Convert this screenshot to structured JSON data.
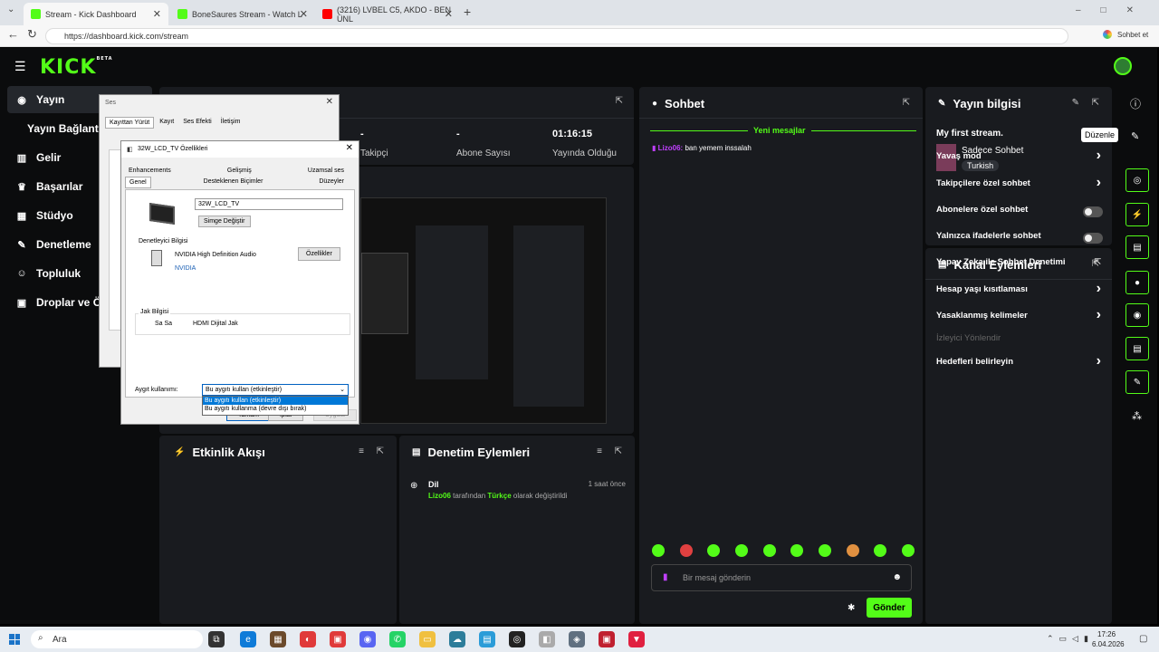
{
  "browser": {
    "tabs": [
      {
        "title": "Stream - Kick Dashboard",
        "color": "#53fc18"
      },
      {
        "title": "BoneSaures Stream - Watch L",
        "color": "#53fc18"
      },
      {
        "title": "(3216) LVBEL C5, AKDO - BEN ÜNL",
        "color": "#ff0000"
      }
    ],
    "url": "https://dashboard.kick.com/stream",
    "chat_label": "Sohbet et"
  },
  "logo": {
    "text": "KICK",
    "badge": "BETA"
  },
  "sidebar": {
    "items": [
      {
        "label": "Yayın",
        "icon": "broadcast-icon"
      },
      {
        "label": "Yayın Bağlantısı",
        "icon": ""
      },
      {
        "label": "Gelir",
        "icon": "chart-icon"
      },
      {
        "label": "Başarılar",
        "icon": "trophy-icon"
      },
      {
        "label": "Stüdyo",
        "icon": "studio-icon"
      },
      {
        "label": "Denetleme",
        "icon": "wrench-icon"
      },
      {
        "label": "Topluluk",
        "icon": "people-icon"
      },
      {
        "label": "Droplar ve Ödüller",
        "icon": "gift-icon"
      }
    ]
  },
  "stats": [
    {
      "value": "-",
      "label": "Takipçi"
    },
    {
      "value": "-",
      "label": "Abone Sayısı"
    },
    {
      "value": "01:16:15",
      "label": "Yayında Olduğu Süre"
    }
  ],
  "chat": {
    "title": "Sohbet",
    "new_messages": "Yeni mesajlar",
    "messages": [
      {
        "user": "Lizo06:",
        "text": "ban yemem inssalah"
      }
    ],
    "input_placeholder": "Bir mesaj gönderin",
    "send_label": "Gönder"
  },
  "stream_info": {
    "title": "Yayın bilgisi",
    "stream_title": "My first stream.",
    "category": "Sadece Sohbet",
    "tag": "Turkish",
    "tooltip": "Düzenle"
  },
  "channel_actions": {
    "title": "Kanal Eylemleri",
    "items": [
      {
        "label": "Yavaş mod",
        "control": "chevron"
      },
      {
        "label": "Takipçilere özel sohbet",
        "control": "chevron"
      },
      {
        "label": "Abonelere özel sohbet",
        "control": "toggle"
      },
      {
        "label": "Yalnızca ifadelerle sohbet",
        "control": "toggle"
      },
      {
        "label": "Yapay Zeka ile Sohbet Denetimi",
        "control": "external"
      },
      {
        "label": "Hesap yaşı kısıtlaması",
        "control": "chevron"
      },
      {
        "label": "Yasaklanmış kelimeler",
        "control": "chevron"
      },
      {
        "label": "İzleyici Yönlendir",
        "control": "disabled"
      },
      {
        "label": "Hedefleri belirleyin",
        "control": "chevron"
      }
    ]
  },
  "activity": {
    "title": "Etkinlik Akışı"
  },
  "moderation": {
    "title": "Denetim Eylemleri",
    "entry_title": "Dil",
    "entry_time": "1 saat önce",
    "entry_user": "Lizo06",
    "entry_mid": "tarafından",
    "entry_value": "Türkçe",
    "entry_tail": "olarak değiştirildi"
  },
  "sound_dialog": {
    "title": "Ses",
    "tabs": [
      "Kayıttan Yürüt",
      "Kayıt",
      "Ses Efekti",
      "İletişim"
    ]
  },
  "props_dialog": {
    "title": "32W_LCD_TV Özellikleri",
    "tabs_row1": [
      "Enhancements",
      "Gelişmiş",
      "Uzamsal ses"
    ],
    "tabs_row2": [
      "Genel",
      "Desteklenen Biçimler",
      "Düzeyler"
    ],
    "device_name": "32W_LCD_TV",
    "change_icon_label": "Simge Değiştir",
    "controller_group": "Denetleyici Bilgisi",
    "controller_name": "NVIDIA High Definition Audio",
    "controller_vendor": "NVIDIA",
    "properties_button": "Özellikler",
    "jack_group": "Jak Bilgisi",
    "jack_side": "Sa Sa",
    "jack_type": "HDMI Dijital Jak",
    "usage_label": "Aygıt kullanımı:",
    "usage_selected": "Bu aygıtı kullan (etkinleştir)",
    "usage_options": [
      "Bu aygıtı kullan (etkinleştir)",
      "Bu aygıtı kullanma (devre dışı bırak)"
    ],
    "ok_label": "Tamam",
    "cancel_label": "İptal",
    "apply_label": "Uygula"
  },
  "taskbar": {
    "search": "Ara",
    "time": "17:26",
    "date": "6.04.2026"
  }
}
